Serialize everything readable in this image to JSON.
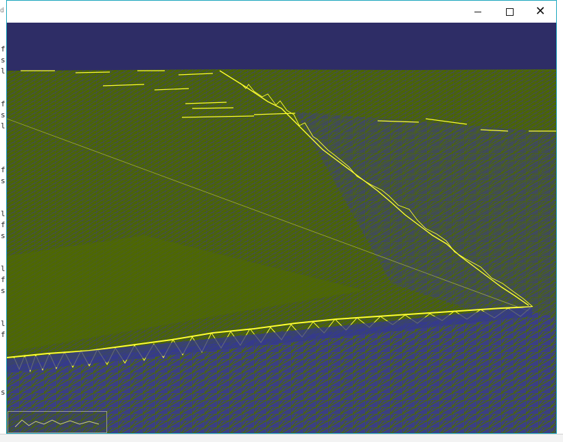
{
  "window": {
    "title": "",
    "controls": {
      "minimize": "minimize",
      "maximize": "maximize",
      "close": "close"
    }
  },
  "background_console": {
    "top_fragment": "d",
    "line_fragments": [
      "f",
      "s",
      "l",
      "f",
      "s",
      "l",
      "f",
      "s",
      "l",
      "f",
      "s",
      "l",
      "f",
      "s",
      "l",
      "f",
      "s"
    ]
  },
  "colors": {
    "sky": "#2e2d66",
    "terrain": "#4a6400",
    "wireframe": "#3d3d8a",
    "highlight": "#ffff33",
    "window_border": "#18a5bd"
  },
  "icons": {
    "minimize": "minimize-icon",
    "maximize": "maximize-icon",
    "close": "close-icon"
  }
}
